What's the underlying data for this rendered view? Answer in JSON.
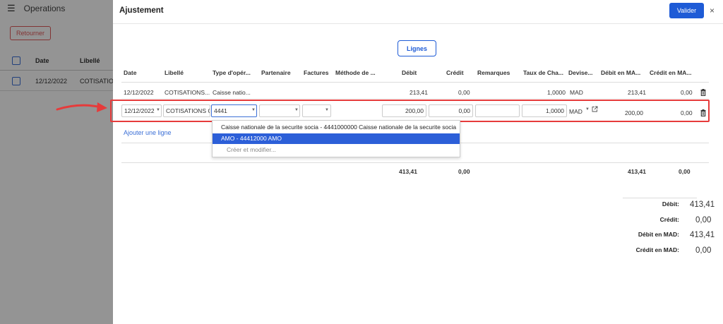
{
  "background": {
    "title": "Operations",
    "retour_label": "Retourner",
    "columns": [
      "Date",
      "Libellé"
    ],
    "row": {
      "date": "12/12/2022",
      "libelle": "COTISATION"
    }
  },
  "modal": {
    "title": "Ajustement",
    "valider_label": "Valider",
    "close_icon": "×",
    "lignes_label": "Lignes"
  },
  "table": {
    "headers": {
      "date": "Date",
      "libelle": "Libellé",
      "type": "Type d'opér...",
      "partenaire": "Partenaire",
      "factures": "Factures",
      "methode": "Méthode de ...",
      "debit": "Débit",
      "credit": "Crédit",
      "remarques": "Remarques",
      "taux": "Taux de Cha...",
      "devise": "Devise...",
      "debit_mad": "Débit en MA...",
      "credit_mad": "Crédit en MA..."
    },
    "row1": {
      "date": "12/12/2022",
      "libelle": "COTISATIONS...",
      "type": "Caisse natio...",
      "debit": "213,41",
      "credit": "0,00",
      "taux": "1,0000",
      "devise": "MAD",
      "debit_mad": "213,41",
      "credit_mad": "0,00"
    },
    "edit_row": {
      "date": "12/12/2022",
      "libelle": "COTISATIONS C",
      "type": "4441",
      "partenaire": "",
      "factures": "",
      "debit": "200,00",
      "credit": "0,00",
      "remarques": "",
      "taux": "1,0000",
      "devise": "MAD",
      "debit_mad": "200,00",
      "credit_mad": "0,00"
    },
    "add_line_label": "Ajouter une ligne",
    "totals": {
      "debit": "413,41",
      "credit": "0,00",
      "debit_mad": "413,41",
      "credit_mad": "0,00"
    }
  },
  "dropdown": {
    "items": [
      "Caisse nationale de la securite socia - 4441000000 Caisse nationale de la securite socia",
      "AMO - 44412000 AMO",
      "Créer et modifier..."
    ]
  },
  "summary": {
    "debit_label": "Débit:",
    "debit_value": "413,41",
    "credit_label": "Crédit:",
    "credit_value": "0,00",
    "debit_mad_label": "Débit en MAD:",
    "debit_mad_value": "413,41",
    "credit_mad_label": "Crédit en MAD:",
    "credit_mad_value": "0,00"
  },
  "colors": {
    "primary": "#1e5bd6",
    "highlight": "#e63b3b",
    "selected": "#2c5fd8"
  }
}
